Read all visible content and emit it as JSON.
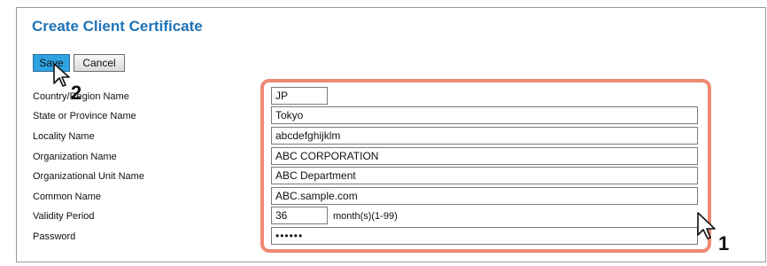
{
  "page": {
    "title": "Create Client Certificate"
  },
  "toolbar": {
    "save_label": "Save",
    "cancel_label": "Cancel"
  },
  "form": {
    "fields": [
      {
        "label": "Country/Region Name",
        "value": "JP"
      },
      {
        "label": "State or Province Name",
        "value": "Tokyo"
      },
      {
        "label": "Locality Name",
        "value": "abcdefghijklm"
      },
      {
        "label": "Organization Name",
        "value": "ABC CORPORATION"
      },
      {
        "label": "Organizational Unit Name",
        "value": "ABC Department"
      },
      {
        "label": "Common Name",
        "value": "ABC.sample.com"
      },
      {
        "label": "Validity Period",
        "value": "36",
        "unit": "month(s)(1-99)"
      },
      {
        "label": "Password",
        "value": "••••••"
      }
    ]
  },
  "annotations": {
    "step_1": "1",
    "step_2": "2",
    "highlight_color": "#ee8a72",
    "cursor_icon": "arrow-cursor-icon"
  },
  "colors": {
    "title": "#1e73b8",
    "save_button": "#2ea3e0"
  }
}
